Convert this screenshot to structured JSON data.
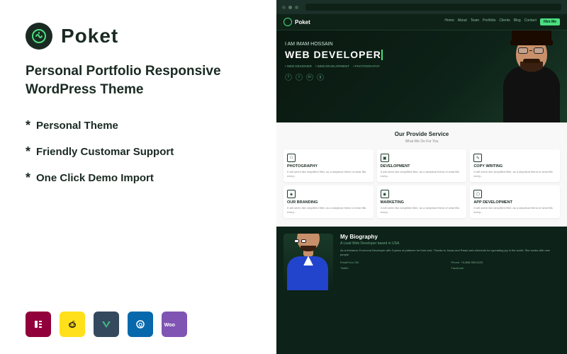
{
  "left": {
    "logo": {
      "text": "Poket",
      "icon": "arrow-logo"
    },
    "tagline": "Personal Portfolio Responsive\nWordPress Theme",
    "features": [
      "Personal Theme",
      "Friendly Customar Support",
      "One Click Demo Import"
    ],
    "plugins": [
      {
        "name": "Elementor",
        "short": "E",
        "type": "elementor"
      },
      {
        "name": "Mailchimp",
        "short": "✉",
        "type": "mailchimp"
      },
      {
        "name": "Vue",
        "short": "V",
        "type": "vuejs"
      },
      {
        "name": "Query",
        "short": "Q",
        "type": "query"
      },
      {
        "name": "WooCommerce",
        "short": "Woo",
        "type": "woo"
      }
    ]
  },
  "right": {
    "nav": {
      "logo": "Poket",
      "links": [
        "Home",
        "About",
        "Team",
        "Portfolio",
        "Clients",
        "Blog",
        "Contact"
      ],
      "cta": "Hire Me"
    },
    "hero": {
      "pre_name": "I AM IMAM HOSSAIN",
      "title": "WEB DEVELOPER",
      "tags": [
        "WEB DESIGNER",
        "WEB DEVELOPMENT",
        "PHOTOGRAPHY"
      ]
    },
    "services": {
      "title": "Our Provide Service",
      "subtitle": "What We Do For You",
      "items": [
        {
          "icon": "📷",
          "title": "PHOTOGRAPHY",
          "desc": "It will seem like simplified filler, as a skeptical friend of what fills every..."
        },
        {
          "icon": "💻",
          "title": "DEVELOPMENT",
          "desc": "It will seem like simplified filler, as a skeptical friend of what fills every..."
        },
        {
          "icon": "✏️",
          "title": "COPY WRITING",
          "desc": "It will seem like simplified filler, as a skeptical friend of what fills every..."
        },
        {
          "icon": "🎨",
          "title": "OUR BRANDING",
          "desc": "It will seem like simplified filler, as a skeptical friend of what fills every..."
        },
        {
          "icon": "📈",
          "title": "MARKETING",
          "desc": "It will seem like simplified filler, as a skeptical friend of what fills every..."
        },
        {
          "icon": "📱",
          "title": "APP DEVELOPMENT",
          "desc": "It will seem like simplified filler, as a skeptical friend of what fills every..."
        }
      ]
    },
    "bio": {
      "title": "My Biography",
      "subtitle": "A Lead Web Developer based in USA",
      "text": "As a freelance Front-end Developer with 3 years of patience for front-end. Thanks to Javan and React web elements for spreading joy in the world. She works with new people.",
      "info": [
        {
          "label": "Email/Your Slit",
          "value": ""
        },
        {
          "label": "Twitter",
          "value": ""
        },
        {
          "label": "Phone",
          "value": "+3-456-789-0123"
        },
        {
          "label": "Facebook",
          "value": ""
        }
      ]
    }
  }
}
